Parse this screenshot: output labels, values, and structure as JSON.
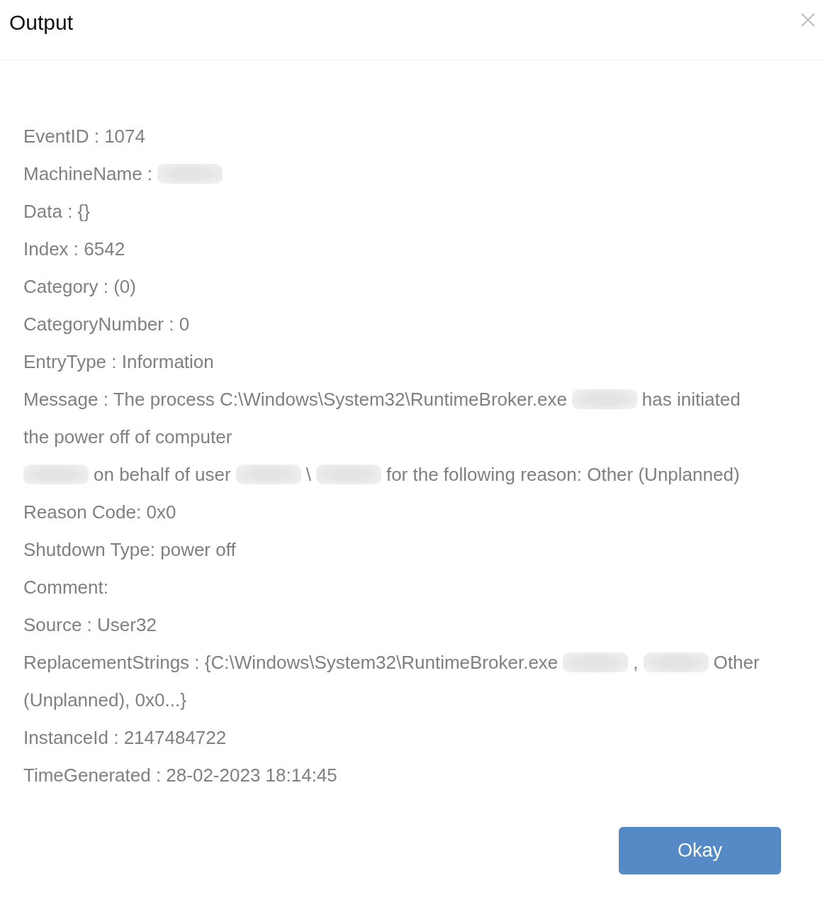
{
  "dialog": {
    "title": "Output"
  },
  "lines": [
    {
      "segments": [
        {
          "kind": "text",
          "text": "EventID : 1074"
        }
      ]
    },
    {
      "segments": [
        {
          "kind": "text",
          "text": "MachineName :"
        },
        {
          "kind": "redacted"
        }
      ]
    },
    {
      "segments": [
        {
          "kind": "text",
          "text": "Data : {}"
        }
      ]
    },
    {
      "segments": [
        {
          "kind": "text",
          "text": "Index : 6542"
        }
      ]
    },
    {
      "segments": [
        {
          "kind": "text",
          "text": "Category : (0)"
        }
      ]
    },
    {
      "segments": [
        {
          "kind": "text",
          "text": "CategoryNumber : 0"
        }
      ]
    },
    {
      "segments": [
        {
          "kind": "text",
          "text": "EntryType : Information"
        }
      ]
    },
    {
      "segments": [
        {
          "kind": "text",
          "text": "Message : The process C:\\Windows\\System32\\RuntimeBroker.exe"
        },
        {
          "kind": "redacted"
        },
        {
          "kind": "text",
          "text": "has initiated"
        }
      ]
    },
    {
      "segments": [
        {
          "kind": "text",
          "text": "the power off of computer"
        }
      ]
    },
    {
      "segments": [
        {
          "kind": "redacted"
        },
        {
          "kind": "text",
          "text": "on behalf of user"
        },
        {
          "kind": "redacted"
        },
        {
          "kind": "text",
          "text": "\\"
        },
        {
          "kind": "redacted"
        },
        {
          "kind": "text",
          "text": "for the following reason: Other (Unplanned)"
        }
      ]
    },
    {
      "segments": [
        {
          "kind": "text",
          "text": "Reason Code: 0x0"
        }
      ]
    },
    {
      "segments": [
        {
          "kind": "text",
          "text": "Shutdown Type: power off"
        }
      ]
    },
    {
      "segments": [
        {
          "kind": "text",
          "text": "Comment:"
        }
      ]
    },
    {
      "segments": [
        {
          "kind": "text",
          "text": "Source : User32"
        }
      ]
    },
    {
      "segments": [
        {
          "kind": "text",
          "text": "ReplacementStrings : {C:\\Windows\\System32\\RuntimeBroker.exe"
        },
        {
          "kind": "redacted"
        },
        {
          "kind": "text",
          "text": ","
        },
        {
          "kind": "redacted"
        },
        {
          "kind": "text",
          "text": "Other"
        }
      ]
    },
    {
      "segments": [
        {
          "kind": "text",
          "text": "(Unplanned), 0x0...}"
        }
      ]
    },
    {
      "segments": [
        {
          "kind": "text",
          "text": "InstanceId : 2147484722"
        }
      ]
    },
    {
      "segments": [
        {
          "kind": "text",
          "text": "TimeGenerated : 28-02-2023 18:14:45"
        }
      ]
    }
  ],
  "button": {
    "label": "Okay"
  }
}
